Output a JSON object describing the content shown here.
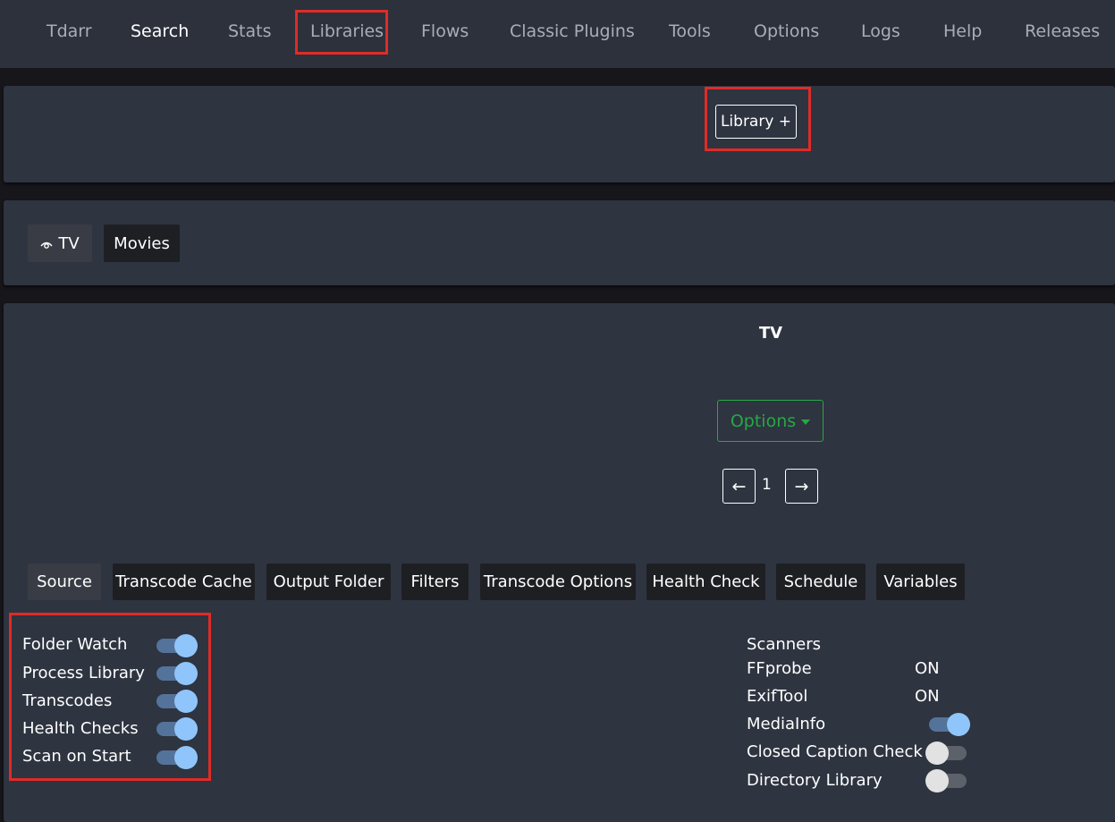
{
  "nav": {
    "items": [
      "Tdarr",
      "Search",
      "Stats",
      "Libraries",
      "Flows",
      "Classic Plugins",
      "Tools",
      "Options",
      "Logs",
      "Help",
      "Releases"
    ]
  },
  "library_add": {
    "label": "Library +"
  },
  "libraries": [
    {
      "label": "TV",
      "selected": true,
      "icon": "eye-icon"
    },
    {
      "label": "Movies",
      "selected": false
    }
  ],
  "library_view": {
    "title": "TV",
    "options_label": "Options",
    "pagination": {
      "prev": "←",
      "page": "1",
      "next": "→"
    }
  },
  "sub_tabs": [
    "Source",
    "Transcode Cache",
    "Output Folder",
    "Filters",
    "Transcode Options",
    "Health Check",
    "Schedule",
    "Variables"
  ],
  "source": {
    "toggles": [
      {
        "label": "Folder Watch",
        "on": true
      },
      {
        "label": "Process Library",
        "on": true
      },
      {
        "label": "Transcodes",
        "on": true
      },
      {
        "label": "Health Checks",
        "on": true
      },
      {
        "label": "Scan on Start",
        "on": true
      }
    ],
    "scanners": {
      "heading": "Scanners",
      "items": [
        {
          "label": "FFprobe",
          "value": "ON"
        },
        {
          "label": "ExifTool",
          "value": "ON"
        },
        {
          "label": "MediaInfo",
          "on": true
        },
        {
          "label": "Closed Caption Check",
          "on": false
        },
        {
          "label": "Directory Library",
          "on": false
        }
      ]
    }
  },
  "colors": {
    "nav_bg": "#2c313c",
    "panel_bg": "#2e3440",
    "page_bg": "#16161b",
    "highlight": "#e02b27",
    "options_green": "#28a745",
    "toggle_on_knob": "#8fc5fa",
    "toggle_on_track": "#54739b"
  }
}
